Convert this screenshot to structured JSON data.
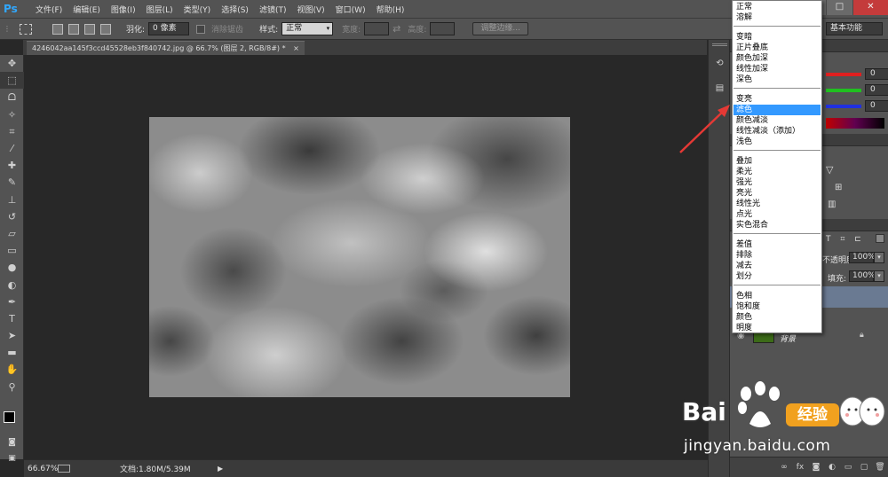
{
  "menubar": {
    "logo": "Ps",
    "items": [
      "文件(F)",
      "编辑(E)",
      "图像(I)",
      "图层(L)",
      "类型(Y)",
      "选择(S)",
      "滤镜(T)",
      "视图(V)",
      "窗口(W)",
      "帮助(H)"
    ]
  },
  "options": {
    "feather_label": "羽化:",
    "feather_value": "0 像素",
    "antialias_label": "消除锯齿",
    "style_label": "样式:",
    "style_value": "正常",
    "width_label": "宽度:",
    "height_label": "高度:",
    "refine_edge": "调整边缘...",
    "workspace": "基本功能"
  },
  "document": {
    "tab_title": "4246042aa145f3ccd45528eb3f840742.jpg @ 66.7% (图层 2, RGB/8#) *",
    "tab_close": "×"
  },
  "status": {
    "zoom": "66.67%",
    "doc_info": "文档:1.80M/5.39M"
  },
  "color_panel": {
    "r": "0",
    "g": "0",
    "b": "0"
  },
  "layers_panel": {
    "opacity_label": "不透明度:",
    "opacity_value": "100%",
    "fill_label": "填充:",
    "fill_value": "100%",
    "bg_layer_name": "背景"
  },
  "blend_menu": {
    "groups": [
      [
        "正常",
        "溶解"
      ],
      [
        "变暗",
        "正片叠底",
        "颜色加深",
        "线性加深",
        "深色"
      ],
      [
        "变亮",
        "滤色",
        "颜色减淡",
        "线性减淡（添加）",
        "浅色"
      ],
      [
        "叠加",
        "柔光",
        "强光",
        "亮光",
        "线性光",
        "点光",
        "实色混合"
      ],
      [
        "差值",
        "排除",
        "减去",
        "划分"
      ],
      [
        "色相",
        "饱和度",
        "颜色",
        "明度"
      ]
    ],
    "selected": "滤色"
  },
  "watermark": {
    "brand": "Bai",
    "brand_cn": "经验",
    "url": "jingyan.baidu.com"
  },
  "colors": {
    "accent_selection": "#3399ff",
    "red_arrow": "#e53935",
    "ps_blue": "#31a8ff"
  }
}
